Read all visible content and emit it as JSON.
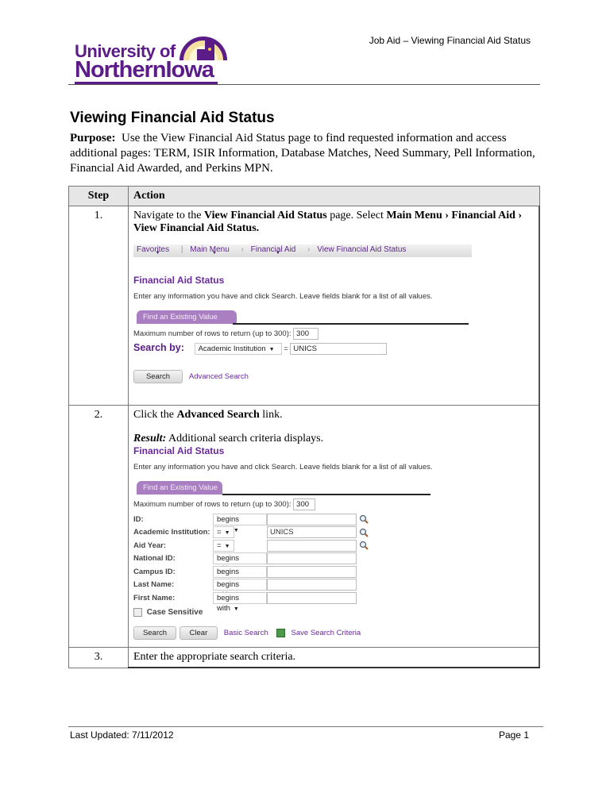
{
  "header": {
    "title": "Job Aid – Viewing Financial Aid Status",
    "logo": {
      "line1": "University of",
      "line2": "NorthernIowa",
      "seal_icon": "university-seal-icon"
    },
    "colors": {
      "brand_purple": "#5b1c87",
      "brand_gold": "#f2c94c"
    }
  },
  "document": {
    "title": "Viewing Financial Aid Status",
    "purpose_label": "Purpose:",
    "purpose_text": "Use the View Financial Aid Status page to find requested information and access additional pages:  TERM, ISIR Information, Database Matches, Need Summary, Pell Information, Financial Aid Awarded, and Perkins MPN."
  },
  "table": {
    "headers": {
      "step": "Step",
      "action": "Action"
    },
    "steps": [
      {
        "number": "1.",
        "text_parts": [
          "Navigate to the ",
          "View Financial Aid Status",
          " page.  Select ",
          "Main Menu › Financial Aid › View Financial Aid Status."
        ]
      },
      {
        "number": "2.",
        "text_parts": [
          "Click the ",
          "Advanced Search",
          " link."
        ],
        "result_label": "Result:",
        "result_text": "  Additional search criteria displays."
      },
      {
        "number": "3.",
        "text": "Enter the appropriate search criteria."
      }
    ]
  },
  "screenshot1": {
    "breadcrumb": [
      "Favorites",
      "Main Menu",
      "Financial Aid",
      "View Financial Aid Status"
    ],
    "breadcrumb_separator": "›",
    "page_title": "Financial Aid Status",
    "instructions": "Enter any information you have and click Search. Leave fields blank for a list of all values.",
    "tab_label": "Find an Existing Value",
    "max_rows_label": "Maximum number of rows to return (up to 300):",
    "max_rows_value": "300",
    "search_by_label": "Search by:",
    "search_by_selected": "Academic Institution",
    "equals": "=",
    "search_value": "UNICS",
    "search_button": "Search",
    "advanced_search_link": "Advanced Search"
  },
  "screenshot2": {
    "page_title": "Financial Aid Status",
    "instructions": "Enter any information you have and click Search. Leave fields blank for a list of all values.",
    "tab_label": "Find an Existing Value",
    "max_rows_label": "Maximum number of rows to return (up to 300):",
    "max_rows_value": "300",
    "fields": [
      {
        "label": "ID:",
        "operator": "begins with",
        "value": "",
        "lookup": true
      },
      {
        "label": "Academic Institution:",
        "operator": "=",
        "value": "UNICS",
        "lookup": true
      },
      {
        "label": "Aid Year:",
        "operator": "=",
        "value": "",
        "lookup": true
      },
      {
        "label": "National ID:",
        "operator": "begins with",
        "value": "",
        "lookup": false
      },
      {
        "label": "Campus ID:",
        "operator": "begins with",
        "value": "",
        "lookup": false
      },
      {
        "label": "Last Name:",
        "operator": "begins with",
        "value": "",
        "lookup": false
      },
      {
        "label": "First Name:",
        "operator": "begins with",
        "value": "",
        "lookup": false
      }
    ],
    "case_sensitive_label": "Case Sensitive",
    "case_sensitive_checked": false,
    "search_button": "Search",
    "clear_button": "Clear",
    "basic_search_link": "Basic Search",
    "save_criteria_link": "Save Search Criteria"
  },
  "footer": {
    "last_updated": "Last Updated: 7/11/2012",
    "page": "Page 1"
  }
}
